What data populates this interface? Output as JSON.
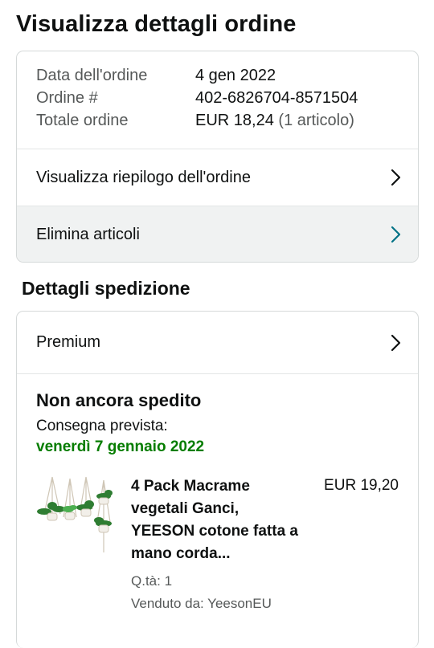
{
  "header": {
    "title": "Visualizza dettagli ordine"
  },
  "order_info": {
    "date_label": "Data dell'ordine",
    "date_value": "4 gen 2022",
    "number_label": "Ordine #",
    "number_value": "402-6826704-8571504",
    "total_label": "Totale ordine",
    "total_value": "EUR 18,24",
    "total_items": "(1 articolo)"
  },
  "actions": {
    "summary_label": "Visualizza riepilogo dell'ordine",
    "delete_label": "Elimina articoli"
  },
  "shipping": {
    "section_title": "Dettagli spedizione",
    "method_label": "Premium",
    "status": "Non ancora spedito",
    "delivery_label": "Consegna prevista:",
    "delivery_date": "venerdì 7 gennaio 2022"
  },
  "product": {
    "title": "4 Pack Macrame vegetali Ganci, YEESON cotone fatta a mano corda...",
    "price": "EUR 19,20",
    "quantity": "Q.tà: 1",
    "seller": "Venduto da: YeesonEU",
    "image_icon": "macrame-plant-hangers-image"
  },
  "colors": {
    "delivery_green": "#067d00",
    "chevron_teal": "#007185",
    "border": "#d5d9d9",
    "shaded_row": "#f0f2f2"
  }
}
